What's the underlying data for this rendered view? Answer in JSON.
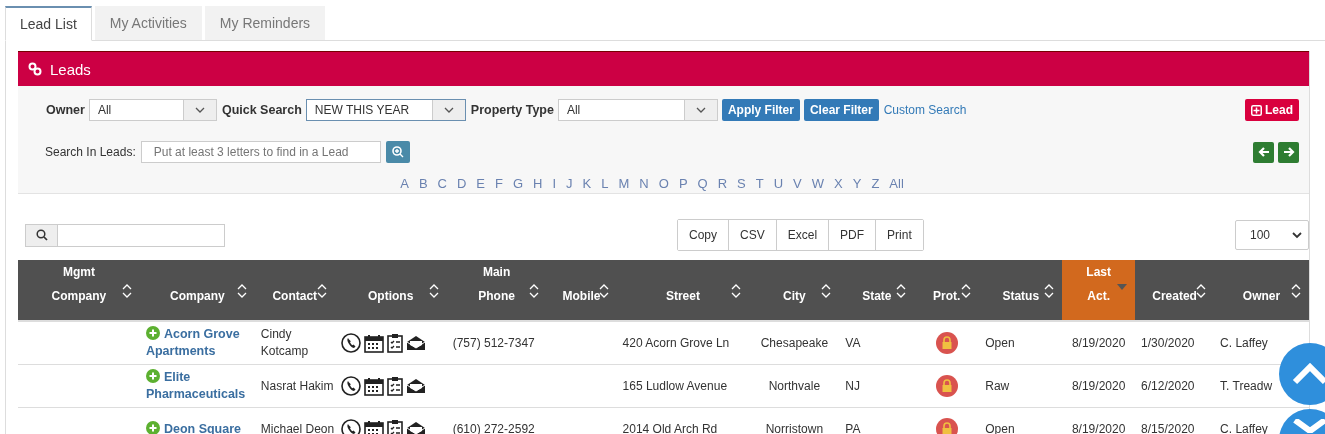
{
  "tabs": [
    {
      "label": "Lead List",
      "selected": true
    },
    {
      "label": "My Activities",
      "selected": false
    },
    {
      "label": "My Reminders",
      "selected": false
    }
  ],
  "panel": {
    "title": "Leads"
  },
  "filters": {
    "owner": {
      "label": "Owner",
      "value": "All"
    },
    "quick_search": {
      "label": "Quick Search",
      "value": "NEW THIS YEAR"
    },
    "property_type": {
      "label": "Property Type",
      "value": "All"
    },
    "apply_button": "Apply Filter",
    "clear_button": "Clear Filter",
    "custom_search_link": "Custom Search",
    "add_lead_button": "Lead",
    "search_label": "Search In Leads:",
    "search_placeholder": "Put at least 3 letters to find in a Lead"
  },
  "alphabet": [
    "A",
    "B",
    "C",
    "D",
    "E",
    "F",
    "G",
    "H",
    "I",
    "J",
    "K",
    "L",
    "M",
    "N",
    "O",
    "P",
    "Q",
    "R",
    "S",
    "T",
    "U",
    "V",
    "W",
    "X",
    "Y",
    "Z",
    "All"
  ],
  "export_buttons": [
    "Copy",
    "CSV",
    "Excel",
    "PDF",
    "Print"
  ],
  "page_size": "100",
  "table": {
    "columns": [
      {
        "label": "Mgmt Company",
        "sorted": false
      },
      {
        "label": "Company",
        "sorted": false
      },
      {
        "label": "Contact",
        "sorted": false
      },
      {
        "label": "Options",
        "sorted": false
      },
      {
        "label": "Main Phone",
        "sorted": false
      },
      {
        "label": "Mobile",
        "sorted": false
      },
      {
        "label": "Street",
        "sorted": false
      },
      {
        "label": "City",
        "sorted": false
      },
      {
        "label": "State",
        "sorted": false
      },
      {
        "label": "Prot.",
        "sorted": false
      },
      {
        "label": "Status",
        "sorted": false
      },
      {
        "label": "Last Act.",
        "sorted": true
      },
      {
        "label": "Created",
        "sorted": false
      },
      {
        "label": "Owner",
        "sorted": false
      }
    ],
    "rows": [
      {
        "company": "Acorn Grove Apartments",
        "contact": "Cindy Kotcamp",
        "main_phone": "(757) 512-7347",
        "street": "420 Acorn Grove Ln",
        "city": "Chesapeake",
        "state": "VA",
        "status": "Open",
        "last_act": "8/19/2020",
        "created": "1/30/2020",
        "owner": "C. Laffey"
      },
      {
        "company": "Elite Pharmaceuticals",
        "contact": "Nasrat Hakim",
        "main_phone": "",
        "street": "165 Ludlow Avenue",
        "city": "Northvale",
        "state": "NJ",
        "status": "Raw",
        "last_act": "8/19/2020",
        "created": "6/12/2020",
        "owner": "T. Treadw"
      },
      {
        "company": "Deon Square",
        "contact": "Michael Deon",
        "main_phone": "(610) 272-2592",
        "street": "2014 Old Arch Rd",
        "city": "Norristown",
        "state": "PA",
        "status": "Open",
        "last_act": "8/19/2020",
        "created": "8/15/2020",
        "owner": "C. Laffey"
      }
    ]
  }
}
